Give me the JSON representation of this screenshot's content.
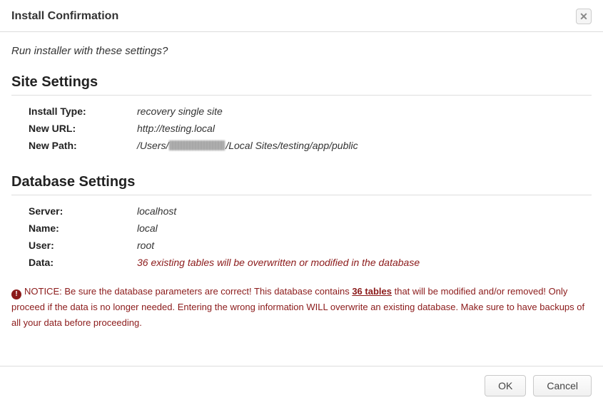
{
  "header": {
    "title": "Install Confirmation"
  },
  "prompt": "Run installer with these settings?",
  "site": {
    "heading": "Site Settings",
    "rows": {
      "install_type": {
        "label": "Install Type:",
        "value": "recovery single site"
      },
      "new_url": {
        "label": "New URL:",
        "value": "http://testing.local"
      },
      "new_path": {
        "label": "New Path:",
        "prefix": "/Users/",
        "suffix": "/Local Sites/testing/app/public"
      }
    }
  },
  "db": {
    "heading": "Database Settings",
    "rows": {
      "server": {
        "label": "Server:",
        "value": "localhost"
      },
      "name": {
        "label": "Name:",
        "value": "local"
      },
      "user": {
        "label": "User:",
        "value": "root"
      },
      "data": {
        "label": "Data:",
        "value": "36 existing tables will be overwritten or modified in the database"
      }
    }
  },
  "notice": {
    "pre": "NOTICE: Be sure the database parameters are correct! This database contains ",
    "link": "36 tables",
    "post": " that will be modified and/or removed! Only proceed if the data is no longer needed. Entering the wrong information WILL overwrite an existing database. Make sure to have backups of all your data before proceeding."
  },
  "buttons": {
    "ok": "OK",
    "cancel": "Cancel"
  }
}
